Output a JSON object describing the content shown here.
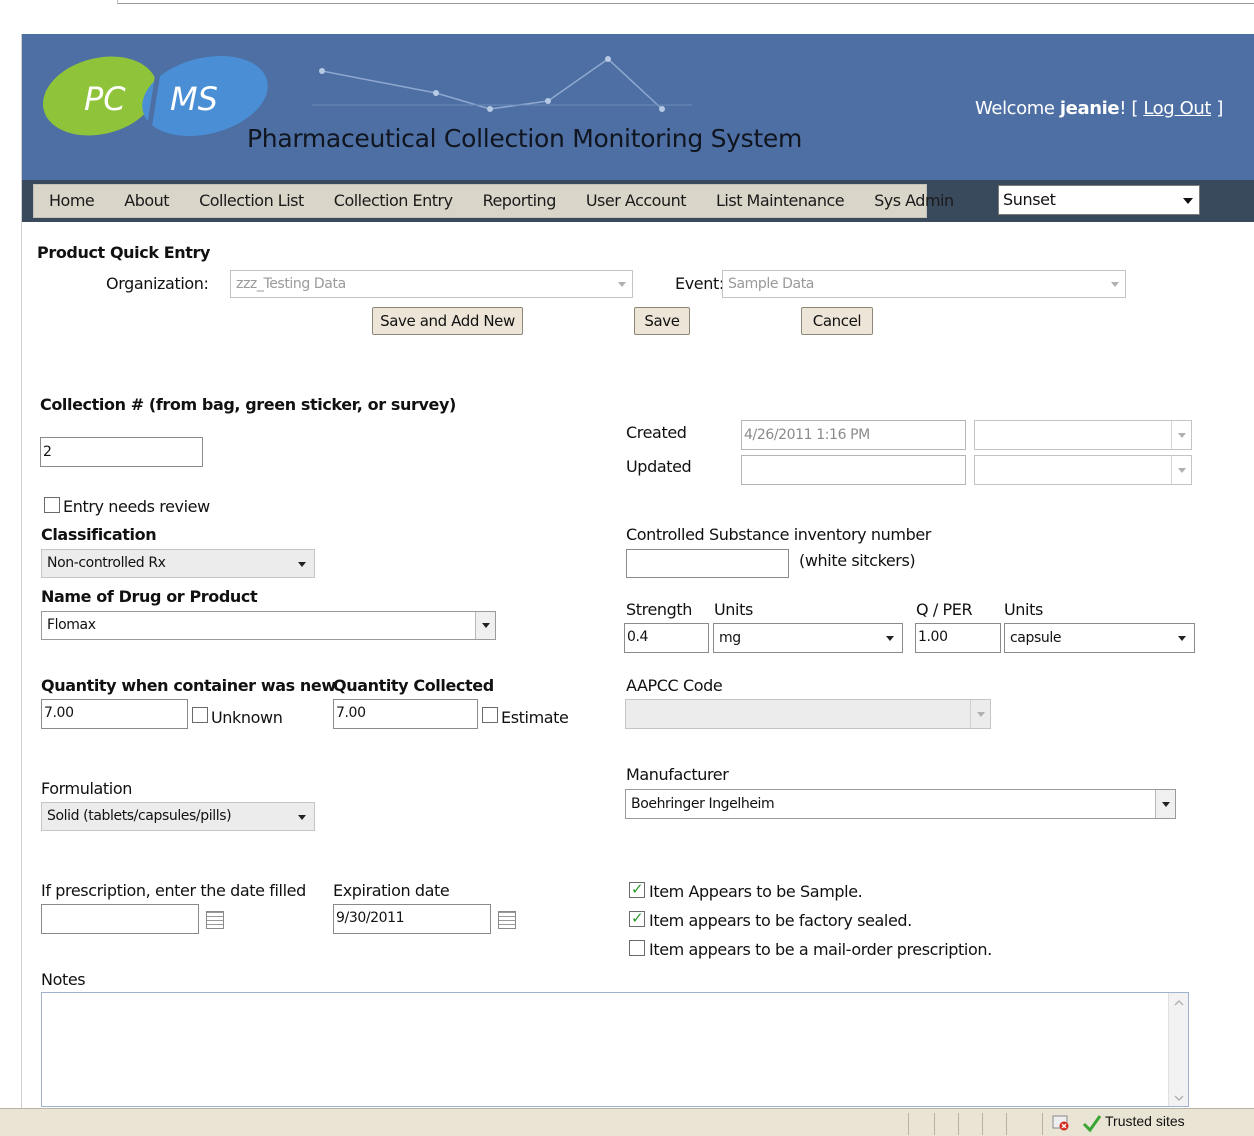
{
  "header": {
    "logo_left": "PC",
    "logo_right": "MS",
    "app_title": "Pharmaceutical Collection Monitoring System",
    "welcome_prefix": "Welcome ",
    "username": "jeanie",
    "welcome_suffix": "! [ ",
    "logout_label": "Log Out",
    "welcome_end": " ]"
  },
  "nav": {
    "items": [
      "Home",
      "About",
      "Collection List",
      "Collection Entry",
      "Reporting",
      "User Account",
      "List Maintenance",
      "Sys Admin"
    ],
    "site_select": "Sunset"
  },
  "quick_entry": {
    "title": "Product Quick Entry",
    "organization_label": "Organization:",
    "organization_value": "zzz_Testing Data",
    "event_label": "Event:",
    "event_value": "Sample Data",
    "save_add_new_label": "Save and Add New",
    "save_label": "Save",
    "cancel_label": "Cancel"
  },
  "form": {
    "collection_label": "Collection # (from bag, green sticker, or survey)",
    "collection_value": "2",
    "created_label": "Created",
    "created_value": "4/26/2011 1:16 PM",
    "updated_label": "Updated",
    "updated_value": "",
    "needs_review_label": "Entry needs review",
    "classification_label": "Classification",
    "classification_value": "Non-controlled Rx",
    "cs_inventory_label": "Controlled Substance inventory number",
    "cs_inventory_note": "(white sitckers)",
    "cs_inventory_value": "",
    "drug_label": "Name of Drug or Product",
    "drug_value": "Flomax",
    "strength_label": "Strength",
    "strength_value": "0.4",
    "units_label": "Units",
    "units_value": "mg",
    "qper_label": "Q / PER",
    "qper_value": "1.00",
    "units2_label": "Units",
    "units2_value": "capsule",
    "qty_new_label": "Quantity when container was new",
    "qty_new_value": "7.00",
    "unknown_label": "Unknown",
    "qty_collected_label": "Quantity Collected",
    "qty_collected_value": "7.00",
    "estimate_label": "Estimate",
    "aapcc_label": "AAPCC Code",
    "aapcc_value": "",
    "formulation_label": "Formulation",
    "formulation_value": "Solid (tablets/capsules/pills)",
    "manufacturer_label": "Manufacturer",
    "manufacturer_value": "Boehringer Ingelheim",
    "rx_date_label": "If prescription, enter the date filled",
    "rx_date_value": "",
    "exp_date_label": "Expiration date",
    "exp_date_value": "9/30/2011",
    "sample_label": "Item Appears to be Sample.",
    "sample_checked": true,
    "sealed_label": "Item appears to be factory sealed.",
    "sealed_checked": true,
    "mail_order_label": "Item appears to be a mail-order prescription.",
    "mail_order_checked": false,
    "notes_label": "Notes",
    "notes_value": ""
  },
  "statusbar": {
    "zone_label": "Trusted sites"
  },
  "colors": {
    "header_bg": "#4d6fa3",
    "nav_band": "#3a4a5d",
    "nav_bar": "#dad5c9",
    "logo_green": "#8fc43a",
    "logo_blue": "#4a8fd6"
  }
}
